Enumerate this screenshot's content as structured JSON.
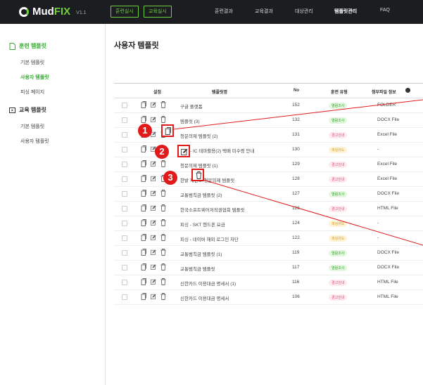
{
  "brand": {
    "name_a": "Mud",
    "name_b": "FIX",
    "version": "V1.1"
  },
  "topbar": {
    "buttons": [
      "훈련실시",
      "교육실시"
    ],
    "nav": [
      "훈련결과",
      "교육결과",
      "대상관리",
      "템플릿관리",
      "FAQ"
    ],
    "active_nav": "템플릿관리"
  },
  "sidebar": {
    "groups": [
      {
        "label": "훈련 템플릿",
        "items": [
          "기본 템플릿",
          "사용자 템플릿",
          "피싱 페이지"
        ]
      },
      {
        "label": "교육 템플릿",
        "items": [
          "기본 템플릿",
          "사용자 템플릿"
        ]
      }
    ]
  },
  "page": {
    "title": "사용자 템플릿"
  },
  "table": {
    "headers": {
      "select": "설정",
      "name": "템플릿명",
      "no": "No",
      "type": "훈련 유형",
      "attach": "첨부파일 정보"
    },
    "rows": [
      {
        "name": "구글 플랫폼",
        "no": "152",
        "type": "열람조사",
        "kind": "green",
        "attach": "FOLDER"
      },
      {
        "name": "템플릿 (3)",
        "no": "132",
        "type": "열람조사",
        "kind": "green",
        "attach": "DOCX File"
      },
      {
        "name": "청문의제 템플릿 (2)",
        "no": "131",
        "type": "경고안내",
        "kind": "pink",
        "attach": "Excel File"
      },
      {
        "name": "[Fw] - IC 테마활용(2) 택배 미수령 안내",
        "no": "130",
        "type": "피싱유도",
        "kind": "yellow",
        "attach": "-"
      },
      {
        "name": "청문의제 템플릿 (1)",
        "no": "129",
        "type": "경고안내",
        "kind": "pink",
        "attach": "Excel File"
      },
      {
        "name": "한밭 재판소 청문의제 템플릿",
        "no": "128",
        "type": "경고안내",
        "kind": "pink",
        "attach": "Excel File"
      },
      {
        "name": "교통범칙금 템플릿 (2)",
        "no": "127",
        "type": "열람조사",
        "kind": "green",
        "attach": "DOCX File"
      },
      {
        "name": "한국소프트웨어저작권협회 템플릿",
        "no": "126",
        "type": "경고안내",
        "kind": "pink",
        "attach": "HTML File"
      },
      {
        "name": "피싱 - SKT 핸드폰 요금",
        "no": "124",
        "type": "피싱유도",
        "kind": "yellow",
        "attach": "-"
      },
      {
        "name": "피싱 - 네이버 해외 로그인 차단",
        "no": "122",
        "type": "피싱유도",
        "kind": "yellow",
        "attach": "-"
      },
      {
        "name": "교통범칙금 템플릿 (1)",
        "no": "119",
        "type": "열람조사",
        "kind": "green",
        "attach": "DOCX File"
      },
      {
        "name": "교통범칙금 템플릿",
        "no": "117",
        "type": "열람조사",
        "kind": "green",
        "attach": "DOCX File"
      },
      {
        "name": "신한카드 이용대금 명세서 (1)",
        "no": "116",
        "type": "경고안내",
        "kind": "pink",
        "attach": "HTML File"
      },
      {
        "name": "신한카드 이용대금 명세서",
        "no": "106",
        "type": "경고안내",
        "kind": "pink",
        "attach": "HTML File"
      }
    ]
  },
  "callouts": [
    "1",
    "2",
    "3"
  ],
  "colors": {
    "accent": "#3aa935",
    "callout": "#e11b1b",
    "topbar": "#1b1d21"
  }
}
